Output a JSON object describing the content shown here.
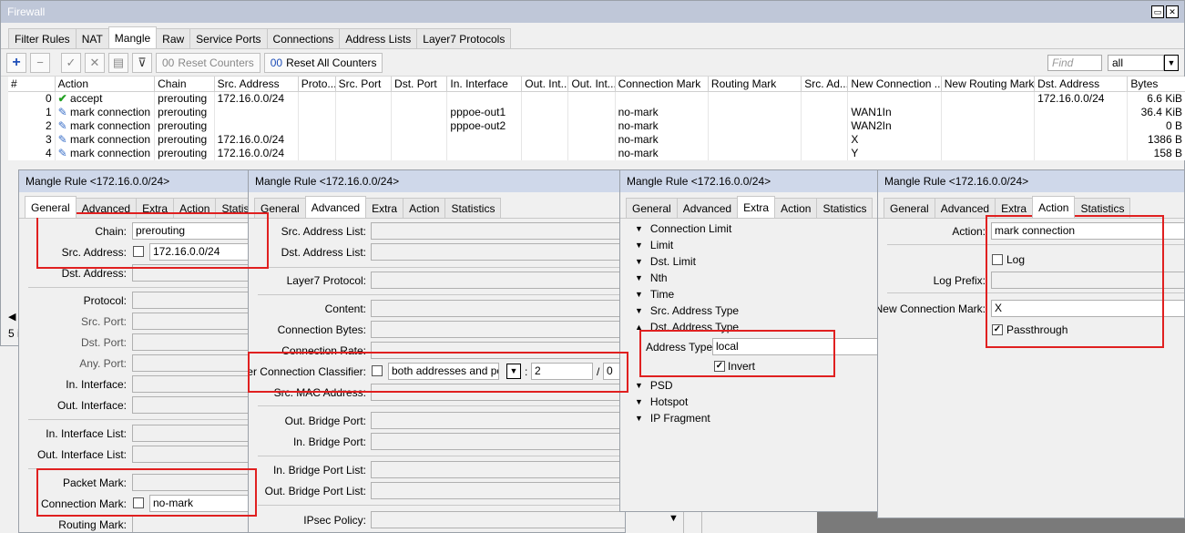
{
  "window": {
    "title": "Firewall"
  },
  "main_tabs": [
    "Filter Rules",
    "NAT",
    "Mangle",
    "Raw",
    "Service Ports",
    "Connections",
    "Address Lists",
    "Layer7 Protocols"
  ],
  "toolbar": {
    "reset_counters": "Reset Counters",
    "reset_all_counters": "Reset All Counters",
    "find_placeholder": "Find",
    "filter_value": "all"
  },
  "table": {
    "columns": [
      "#",
      "Action",
      "Chain",
      "Src. Address",
      "Proto...",
      "Src. Port",
      "Dst. Port",
      "In. Interface",
      "Out. Int...",
      "Out. Int...",
      "Connection Mark",
      "Routing Mark",
      "Src. Ad...",
      "New Connection ...",
      "New Routing Mark",
      "Dst. Address",
      "Bytes"
    ],
    "rows": [
      {
        "num": "0",
        "action": "accept",
        "chain": "prerouting",
        "src": "172.16.0.0/24",
        "inif": "",
        "connmark": "",
        "newconn": "",
        "dst": "172.16.0.0/24",
        "bytes": "6.6 KiB"
      },
      {
        "num": "1",
        "action": "mark connection",
        "chain": "prerouting",
        "src": "",
        "inif": "pppoe-out1",
        "connmark": "no-mark",
        "newconn": "WAN1In",
        "dst": "",
        "bytes": "36.4 KiB"
      },
      {
        "num": "2",
        "action": "mark connection",
        "chain": "prerouting",
        "src": "",
        "inif": "pppoe-out2",
        "connmark": "no-mark",
        "newconn": "WAN2In",
        "dst": "",
        "bytes": "0 B"
      },
      {
        "num": "3",
        "action": "mark connection",
        "chain": "prerouting",
        "src": "172.16.0.0/24",
        "inif": "",
        "connmark": "no-mark",
        "newconn": "X",
        "dst": "",
        "bytes": "1386 B"
      },
      {
        "num": "4",
        "action": "mark connection",
        "chain": "prerouting",
        "src": "172.16.0.0/24",
        "inif": "",
        "connmark": "no-mark",
        "newconn": "Y",
        "dst": "",
        "bytes": "158 B"
      }
    ],
    "status_left": "5 i"
  },
  "dialog_title": "Mangle Rule <172.16.0.0/24>",
  "dialog_tabs": [
    "General",
    "Advanced",
    "Extra",
    "Action",
    "Statistics"
  ],
  "general": {
    "chain_label": "Chain:",
    "chain_value": "prerouting",
    "src_label": "Src. Address:",
    "src_value": "172.16.0.0/24",
    "dst_label": "Dst. Address:",
    "protocol_label": "Protocol:",
    "src_port_label": "Src. Port:",
    "dst_port_label": "Dst. Port:",
    "any_port_label": "Any. Port:",
    "in_if_label": "In. Interface:",
    "out_if_label": "Out. Interface:",
    "in_if_list_label": "In. Interface List:",
    "out_if_list_label": "Out. Interface List:",
    "packet_mark_label": "Packet Mark:",
    "conn_mark_label": "Connection Mark:",
    "conn_mark_value": "no-mark",
    "routing_mark_label": "Routing Mark:"
  },
  "advanced": {
    "src_list_label": "Src. Address List:",
    "dst_list_label": "Dst. Address List:",
    "l7_label": "Layer7 Protocol:",
    "content_label": "Content:",
    "conn_bytes_label": "Connection Bytes:",
    "conn_rate_label": "Connection Rate:",
    "pcc_label": "Per Connection Classifier:",
    "pcc_value": "both addresses and ports",
    "pcc_denom": "2",
    "pcc_rem": "0",
    "src_mac_label": "Src. MAC Address:",
    "out_bridge_port_label": "Out. Bridge Port:",
    "in_bridge_port_label": "In. Bridge Port:",
    "in_bridge_list_label": "In. Bridge Port List:",
    "out_bridge_list_label": "Out. Bridge Port List:",
    "ipsec_label": "IPsec Policy:"
  },
  "extra": {
    "items_top": [
      "Connection Limit",
      "Limit",
      "Dst. Limit",
      "Nth",
      "Time",
      "Src. Address Type",
      "Dst. Address Type"
    ],
    "address_type_label": "Address Type:",
    "address_type_value": "local",
    "invert_label": "Invert",
    "items_bottom": [
      "PSD",
      "Hotspot",
      "IP Fragment"
    ]
  },
  "action": {
    "action_label": "Action:",
    "action_value": "mark connection",
    "log_label": "Log",
    "log_prefix_label": "Log Prefix:",
    "new_conn_mark_label": "New Connection Mark:",
    "new_conn_mark_value": "X",
    "passthrough_label": "Passthrough"
  }
}
